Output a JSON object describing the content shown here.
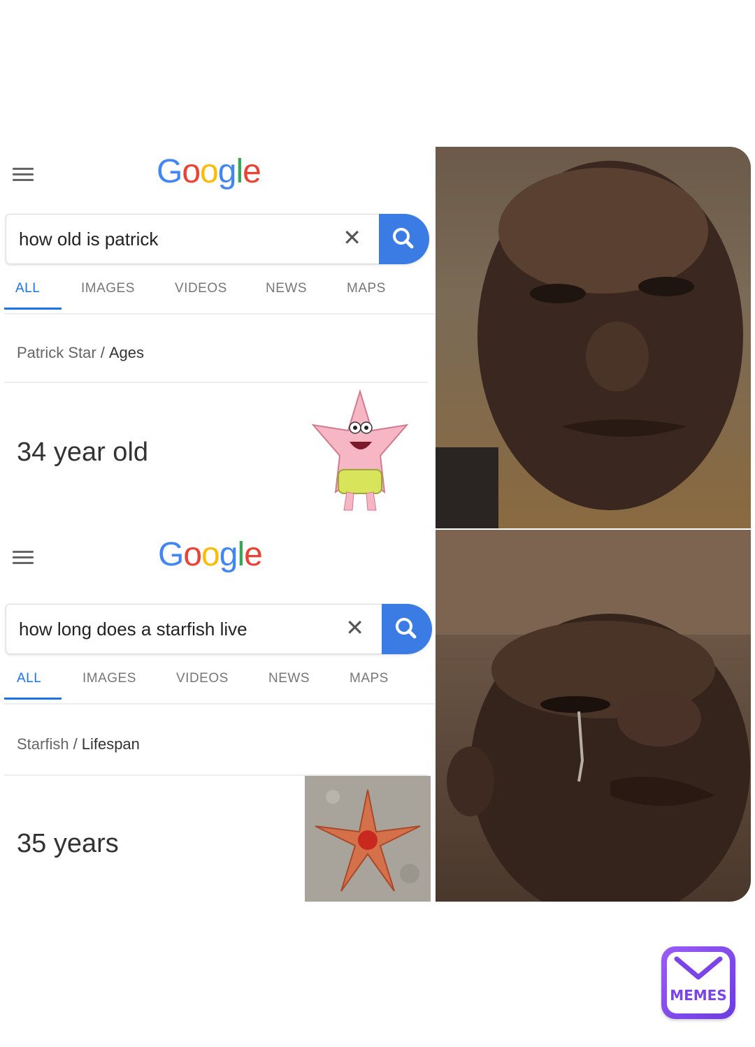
{
  "panels": [
    {
      "logo": [
        "G",
        "o",
        "o",
        "g",
        "l",
        "e"
      ],
      "query": "how old is patrick",
      "clear_glyph": "✕",
      "tabs": [
        "ALL",
        "IMAGES",
        "VIDEOS",
        "NEWS",
        "MAPS"
      ],
      "breadcrumb_parent": "Patrick Star",
      "breadcrumb_sep": "/",
      "breadcrumb_leaf": "Ages",
      "answer": "34 year old",
      "thumbnail": "patrick-star-image"
    },
    {
      "logo": [
        "G",
        "o",
        "o",
        "g",
        "l",
        "e"
      ],
      "query": "how long does a starfish live",
      "clear_glyph": "✕",
      "tabs": [
        "ALL",
        "IMAGES",
        "VIDEOS",
        "NEWS",
        "MAPS"
      ],
      "breadcrumb_parent": "Starfish",
      "breadcrumb_sep": "/",
      "breadcrumb_leaf": "Lifespan",
      "answer": "35 years",
      "thumbnail": "starfish-photo"
    }
  ],
  "colors": {
    "google_blue": "#4285f4",
    "google_red": "#ea4335",
    "google_yellow": "#fbbc05",
    "google_green": "#34a853",
    "search_button": "#3a7be4",
    "active_tab": "#1a73e8"
  },
  "watermark": {
    "text": "MEMES",
    "icon": "envelope-icon"
  }
}
